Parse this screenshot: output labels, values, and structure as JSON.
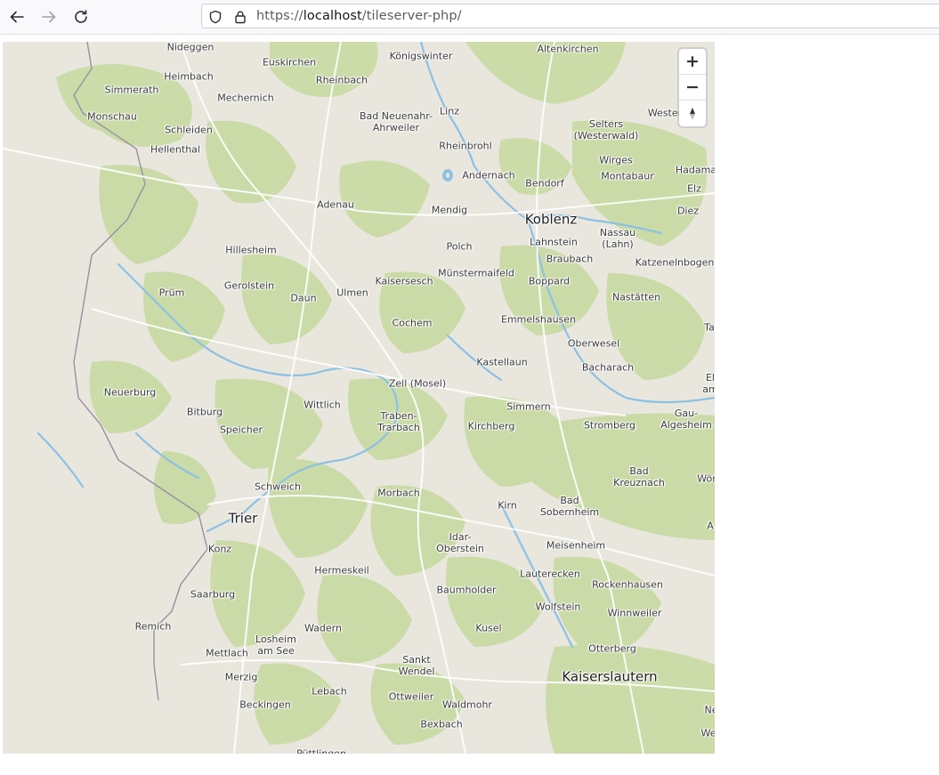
{
  "browser": {
    "url_prefix": "https://",
    "url_host": "localhost",
    "url_path": "/tileserver-php/",
    "icons": {
      "back": "arrow-left-icon",
      "forward": "arrow-right-icon",
      "reload": "reload-icon",
      "shield": "shield-icon",
      "lock": "lock-icon"
    }
  },
  "map": {
    "controls": {
      "zoom_in": "+",
      "zoom_out": "−",
      "compass": "compass-icon"
    },
    "colors": {
      "land": "#e9e6de",
      "forest": "#c9dba5",
      "water": "#8dc1e3",
      "road": "#ffffff",
      "border": "#9a8fa0"
    },
    "places": [
      {
        "name": "Nideggen"
      },
      {
        "name": "Euskirchen"
      },
      {
        "name": "Königswinter"
      },
      {
        "name": "Altenkirchen"
      },
      {
        "name": "Heimbach"
      },
      {
        "name": "Rheinbach"
      },
      {
        "name": "Simmerath"
      },
      {
        "name": "Mechernich"
      },
      {
        "name": "Linz"
      },
      {
        "name": "Bad Neuenahr-\nAhrweiler"
      },
      {
        "name": "Monschau"
      },
      {
        "name": "Selters\n(Westerwald)"
      },
      {
        "name": "Wester"
      },
      {
        "name": "Schleiden"
      },
      {
        "name": "Rheinbrohl"
      },
      {
        "name": "Hellenthal"
      },
      {
        "name": "Wirges"
      },
      {
        "name": "Andernach"
      },
      {
        "name": "Hadama"
      },
      {
        "name": "Montabaur"
      },
      {
        "name": "Bendorf"
      },
      {
        "name": "Elz"
      },
      {
        "name": "Adenau"
      },
      {
        "name": "Mendig"
      },
      {
        "name": "Koblenz",
        "big": true
      },
      {
        "name": "Diez"
      },
      {
        "name": "Nassau\n(Lahn)"
      },
      {
        "name": "Lahnstein"
      },
      {
        "name": "Polch"
      },
      {
        "name": "Hillesheim"
      },
      {
        "name": "Braubach"
      },
      {
        "name": "Katzenelnbogen"
      },
      {
        "name": "Münstermaifeld"
      },
      {
        "name": "Gerolstein"
      },
      {
        "name": "Kaisersesch"
      },
      {
        "name": "Boppard"
      },
      {
        "name": "Prüm"
      },
      {
        "name": "Ulmen"
      },
      {
        "name": "Daun"
      },
      {
        "name": "Nastätten"
      },
      {
        "name": "Emmelshausen"
      },
      {
        "name": "Cochem"
      },
      {
        "name": "Ta"
      },
      {
        "name": "Oberwesel"
      },
      {
        "name": "Kastellaun"
      },
      {
        "name": "Bacharach"
      },
      {
        "name": "El\nam"
      },
      {
        "name": "Zell (Mosel)"
      },
      {
        "name": "Neuerburg"
      },
      {
        "name": "Wittlich"
      },
      {
        "name": "Simmern"
      },
      {
        "name": "Gau-\nAlgesheim"
      },
      {
        "name": "Bitburg"
      },
      {
        "name": "Traben-\nTrarbach"
      },
      {
        "name": "Kirchberg"
      },
      {
        "name": "Stromberg"
      },
      {
        "name": "Speicher"
      },
      {
        "name": "Bad\nKreuznach"
      },
      {
        "name": "Wör"
      },
      {
        "name": "Schweich"
      },
      {
        "name": "Morbach"
      },
      {
        "name": "Bad\nSobernheim"
      },
      {
        "name": "Kirn"
      },
      {
        "name": "Trier",
        "big": true
      },
      {
        "name": "A"
      },
      {
        "name": "Idar-\nOberstein"
      },
      {
        "name": "Konz"
      },
      {
        "name": "Meisenheim"
      },
      {
        "name": "Hermeskeil"
      },
      {
        "name": "Lauterecken"
      },
      {
        "name": "Rockenhausen"
      },
      {
        "name": "Saarburg"
      },
      {
        "name": "Baumholder"
      },
      {
        "name": "Wolfstein"
      },
      {
        "name": "Winnweiler"
      },
      {
        "name": "Remich"
      },
      {
        "name": "Wadern"
      },
      {
        "name": "Kusel"
      },
      {
        "name": "Losheim\nam See"
      },
      {
        "name": "Otterberg"
      },
      {
        "name": "Mettlach"
      },
      {
        "name": "Sankt\nWendel"
      },
      {
        "name": "Merzig"
      },
      {
        "name": "Kaiserslautern",
        "big": true
      },
      {
        "name": "Lebach"
      },
      {
        "name": "Ottweiler"
      },
      {
        "name": "Beckingen"
      },
      {
        "name": "Waldmohr"
      },
      {
        "name": "Ne"
      },
      {
        "name": "We"
      },
      {
        "name": "Bexbach"
      },
      {
        "name": "Püttlingen"
      }
    ]
  }
}
